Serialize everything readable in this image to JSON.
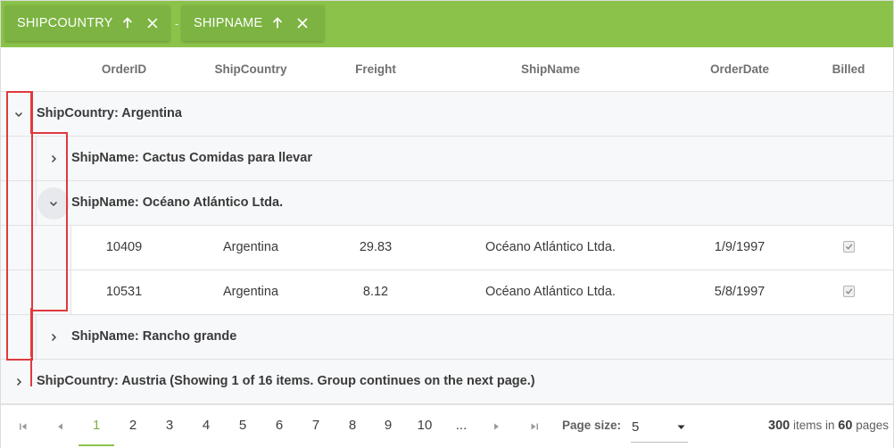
{
  "group_panel": {
    "chips": [
      {
        "label": "SHIPCOUNTRY",
        "sort": "ascending"
      },
      {
        "label": "SHIPNAME",
        "sort": "ascending"
      }
    ],
    "separator": "-"
  },
  "columns": [
    "OrderID",
    "ShipCountry",
    "Freight",
    "ShipName",
    "OrderDate",
    "Billed"
  ],
  "rows": {
    "g_argentina": "ShipCountry: Argentina",
    "g_cactus": "ShipName: Cactus Comidas para llevar",
    "g_oceano": "ShipName: Océano Atlántico Ltda.",
    "r1": {
      "order_id": "10409",
      "ship_country": "Argentina",
      "freight": "29.83",
      "ship_name": "Océano Atlántico Ltda.",
      "order_date": "1/9/1997",
      "billed": true
    },
    "r2": {
      "order_id": "10531",
      "ship_country": "Argentina",
      "freight": "8.12",
      "ship_name": "Océano Atlántico Ltda.",
      "order_date": "5/8/1997",
      "billed": true
    },
    "g_rancho": "ShipName: Rancho grande",
    "g_austria": "ShipCountry: Austria (Showing 1 of 16 items. Group continues on the next page.)"
  },
  "pager": {
    "pages": [
      "1",
      "2",
      "3",
      "4",
      "5",
      "6",
      "7",
      "8",
      "9",
      "10",
      "..."
    ],
    "current_page": "1",
    "page_size_label": "Page size:",
    "page_size": "5",
    "total_items": "300",
    "items_in_text": "items in",
    "total_pages": "60",
    "pages_text": "pages"
  },
  "colors": {
    "accent": "#8bc34a",
    "chip": "#7cb342",
    "highlight": "#e0393e"
  },
  "icons": [
    "arrow-up-icon",
    "close-icon",
    "chevron-down-icon",
    "chevron-right-icon",
    "first-page-icon",
    "prev-page-icon",
    "next-page-icon",
    "last-page-icon",
    "checkbox-checked-icon"
  ]
}
